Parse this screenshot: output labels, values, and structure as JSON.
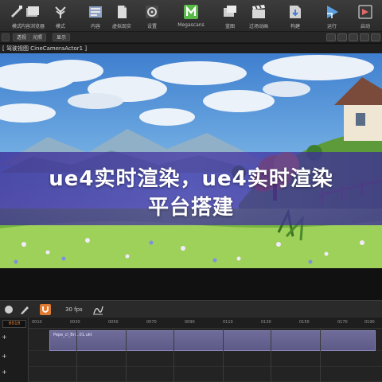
{
  "toolbar": {
    "buttons": [
      {
        "label": "模式",
        "icon": "mode-icon"
      },
      {
        "label": "内容浏览器",
        "icon": "content-browser-icon"
      },
      {
        "label": "模式",
        "icon": "foliage-icon"
      },
      {
        "label": "内容",
        "icon": "content-icon"
      },
      {
        "label": "虚拟现实",
        "icon": "blueprint-icon"
      },
      {
        "label": "设置",
        "icon": "settings-icon"
      },
      {
        "label": "Megascans",
        "icon": "megascans-icon"
      },
      {
        "label": "蓝图",
        "icon": "blueprint-editor-icon"
      },
      {
        "label": "过场动画",
        "icon": "cinematics-icon"
      },
      {
        "label": "构建",
        "icon": "build-icon"
      },
      {
        "label": "运行",
        "icon": "play-icon"
      },
      {
        "label": "启动",
        "icon": "launch-icon"
      }
    ]
  },
  "viewport_header": {
    "perspective": "透视",
    "lit": "光照",
    "show": "显示"
  },
  "camera_bar": {
    "text": "[ 驾驶视图 CineCameraActor1 ]"
  },
  "title": {
    "line1": "ue4实时渲染，ue4实时渲染",
    "line2": "平台搭建"
  },
  "sequencer": {
    "fps": "30 fps",
    "frame": "0010",
    "ruler_ticks": [
      "0010",
      "0030",
      "0050",
      "0070",
      "0090",
      "0110",
      "0130",
      "0150",
      "0170",
      "0190"
    ],
    "clip_label": "Pepe_cl_Bn1.01.ukt",
    "track_rows": [
      "+",
      "+",
      "+"
    ]
  },
  "colors": {
    "accent": "#e07a30",
    "band": "#4a36a8",
    "clip": "#6f6c9a"
  }
}
